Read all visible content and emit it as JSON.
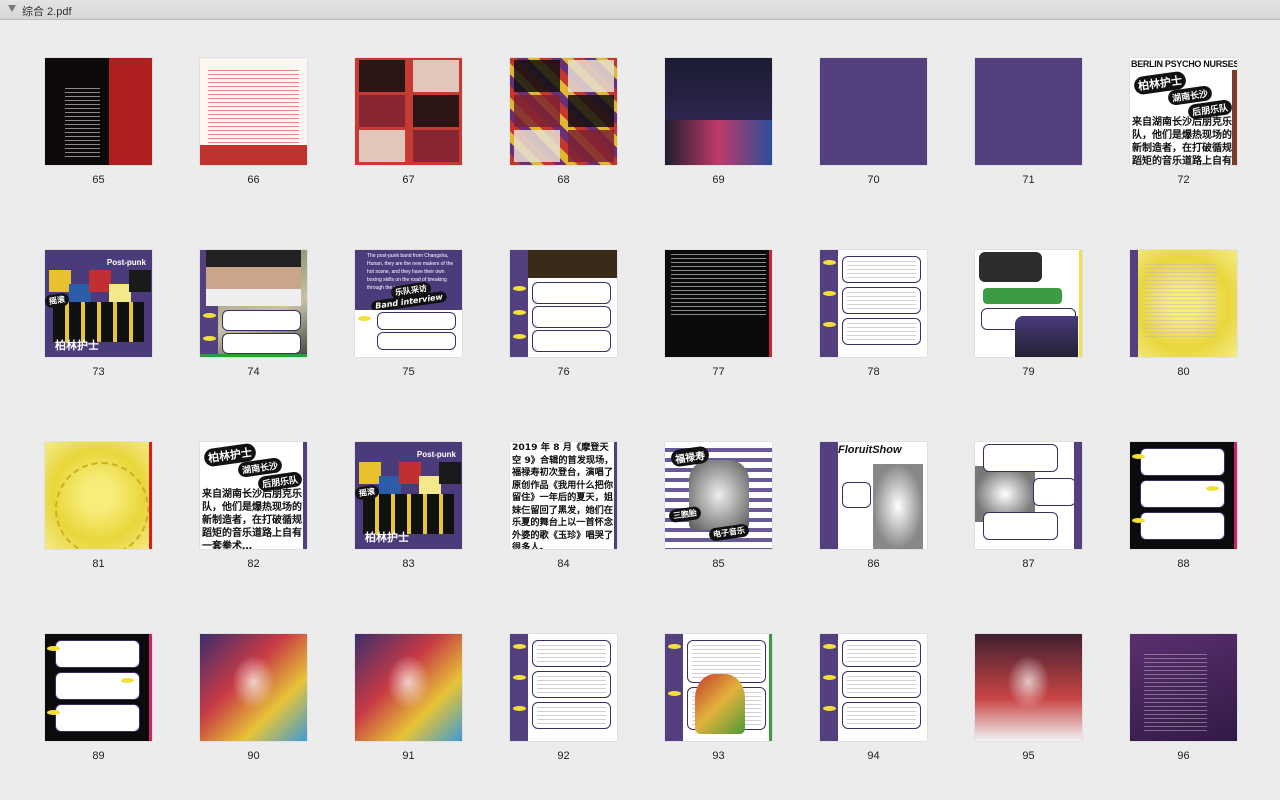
{
  "window": {
    "title": "综合 2.pdf"
  },
  "pages": [
    {
      "num": "65",
      "style": "t-darkred",
      "kind": "dark-text"
    },
    {
      "num": "66",
      "style": "t-textpage",
      "kind": "red-text"
    },
    {
      "num": "67",
      "style": "t-redpanel",
      "kind": "collage"
    },
    {
      "num": "68",
      "style": "t-collage",
      "kind": "collage"
    },
    {
      "num": "69",
      "style": "t-poster",
      "kind": "poster"
    },
    {
      "num": "70",
      "style": "t-purple",
      "kind": "plain"
    },
    {
      "num": "71",
      "style": "t-purple",
      "kind": "plain"
    },
    {
      "num": "72",
      "style": "t-berlin",
      "kind": "berlin"
    },
    {
      "num": "73",
      "style": "t-interview",
      "kind": "collage-post"
    },
    {
      "num": "74",
      "style": "t-photo",
      "kind": "photo-boxes"
    },
    {
      "num": "75",
      "style": "t-interview",
      "kind": "interview"
    },
    {
      "num": "76",
      "style": "t-white",
      "kind": "boxes-dark"
    },
    {
      "num": "77",
      "style": "t-black",
      "kind": "black-text"
    },
    {
      "num": "78",
      "style": "t-white",
      "kind": "boxes"
    },
    {
      "num": "79",
      "style": "t-white",
      "kind": "boxes-photo"
    },
    {
      "num": "80",
      "style": "t-yellow",
      "kind": "yellow-list"
    },
    {
      "num": "81",
      "style": "t-yellow",
      "kind": "yellow"
    },
    {
      "num": "82",
      "style": "t-berlin",
      "kind": "berlin2"
    },
    {
      "num": "83",
      "style": "t-interview",
      "kind": "collage-post"
    },
    {
      "num": "84",
      "style": "t-white",
      "kind": "chinese-text"
    },
    {
      "num": "85",
      "style": "t-white",
      "kind": "fuluoshou"
    },
    {
      "num": "86",
      "style": "t-white",
      "kind": "florist"
    },
    {
      "num": "87",
      "style": "t-white",
      "kind": "boxes-photo2"
    },
    {
      "num": "88",
      "style": "t-black",
      "kind": "black-boxes"
    },
    {
      "num": "89",
      "style": "t-black",
      "kind": "black-boxes"
    },
    {
      "num": "90",
      "style": "t-dance",
      "kind": "photo"
    },
    {
      "num": "91",
      "style": "t-dance",
      "kind": "photo"
    },
    {
      "num": "92",
      "style": "t-white",
      "kind": "boxes"
    },
    {
      "num": "93",
      "style": "t-white",
      "kind": "boxes-art"
    },
    {
      "num": "94",
      "style": "t-white",
      "kind": "boxes"
    },
    {
      "num": "95",
      "style": "t-stage",
      "kind": "photo"
    },
    {
      "num": "96",
      "style": "t-violet",
      "kind": "violet-list"
    }
  ],
  "texts": {
    "berlin_header": "BERLIN PSYCHO NURSES",
    "berlin_cn": "柏林护士",
    "hunan": "湖南长沙",
    "postpunk_cn": "后朋乐队",
    "berlin_body": "来自湖南长沙后朋克乐队，他们是爆热现场的新制造者，在打破循规蹈矩的音乐道路上自有一套拳术…",
    "post_punk": "Post-punk",
    "band_interview_cn": "乐队采访",
    "band_interview": "Band interview",
    "interview_lead": "The post-punk band from Changsha, Hunan, they are the new makers of the hot scene, and they have their own boxing skills on the road of breaking through the rules of music...",
    "ch84": "2019 年 8 月《摩登天空 9》合辑的首发现场，福禄寿初次登台，演唱了原创作品《我用什么把你留住》一年后的夏天，姐妹仨留回了黑发，她们在乐夏的舞台上以一首怀念外婆的歌《玉珍》唱哭了很多人。",
    "fuluoshou": "福禄寿",
    "sanbaotai": "三胞胎",
    "dianzi": "电子音乐",
    "florist": "FloruitShow",
    "yaogun": "摇滚"
  }
}
